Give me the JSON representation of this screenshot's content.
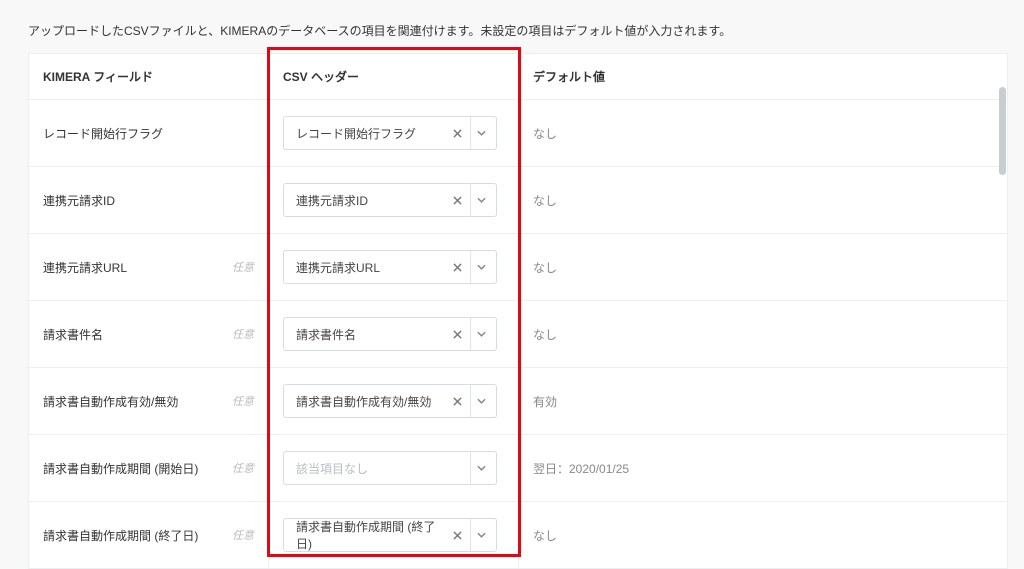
{
  "description": "アップロードしたCSVファイルと、KIMERAのデータベースの項目を関連付けます。未設定の項目はデフォルト値が入力されます。",
  "optional_label": "任意",
  "headers": {
    "field": "KIMERA フィールド",
    "csv": "CSV ヘッダー",
    "default": "デフォルト値"
  },
  "select_placeholder": "該当項目なし",
  "rows": [
    {
      "field": "レコード開始行フラグ",
      "optional": false,
      "csv": "レコード開始行フラグ",
      "hasValue": true,
      "default": "なし"
    },
    {
      "field": "連携元請求ID",
      "optional": false,
      "csv": "連携元請求ID",
      "hasValue": true,
      "default": "なし"
    },
    {
      "field": "連携元請求URL",
      "optional": true,
      "csv": "連携元請求URL",
      "hasValue": true,
      "default": "なし"
    },
    {
      "field": "請求書件名",
      "optional": true,
      "csv": "請求書件名",
      "hasValue": true,
      "default": "なし"
    },
    {
      "field": "請求書自動作成有効/無効",
      "optional": true,
      "csv": "請求書自動作成有効/無効",
      "hasValue": true,
      "default": "有効"
    },
    {
      "field": "請求書自動作成期間 (開始日)",
      "optional": true,
      "csv": "",
      "hasValue": false,
      "default": "翌日：2020/01/25"
    },
    {
      "field": "請求書自動作成期間 (終了日)",
      "optional": true,
      "csv": "請求書自動作成期間 (終了日)",
      "hasValue": true,
      "default": "なし"
    }
  ]
}
